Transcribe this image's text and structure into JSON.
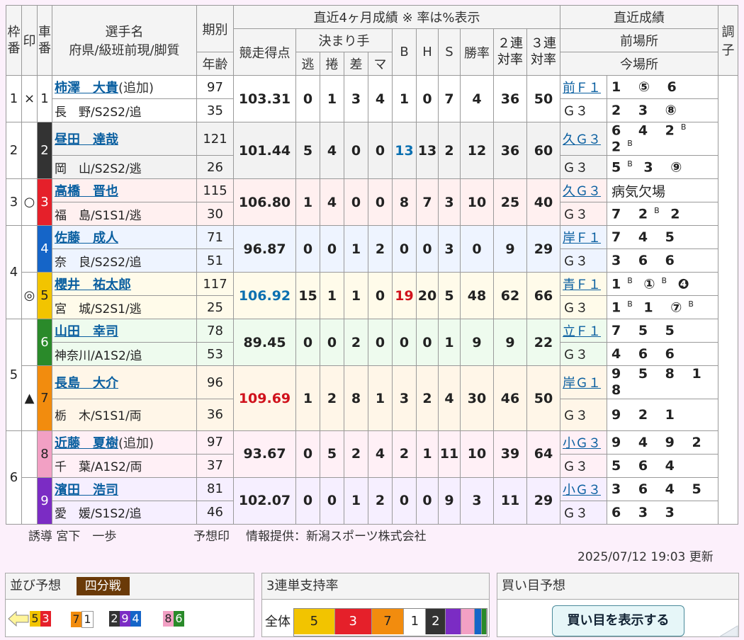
{
  "header": {
    "col_waku": "枠番",
    "col_mark": "印",
    "col_car": "車番",
    "col_name": "選手名",
    "col_name_sub": "府県/級班前現/脚質",
    "col_term": "期別",
    "col_age": "年齢",
    "col_recent4": "直近4ヶ月成績 ※ 率は%表示",
    "col_score": "競走得点",
    "col_kimarite": "決まり手",
    "col_nige": "逃",
    "col_makuri": "捲",
    "col_sashi": "差",
    "col_ma": "マ",
    "col_b": "B",
    "col_h": "H",
    "col_s": "S",
    "col_win": "勝率",
    "col_ren2_a": "２連",
    "col_ren2_b": "対率",
    "col_ren3_a": "３連",
    "col_ren3_b": "対率",
    "col_recent": "直近成績",
    "col_prev": "前場所",
    "col_current": "今場所",
    "col_cond_a": "調",
    "col_cond_b": "子"
  },
  "riders": [
    {
      "waku": "1",
      "mark": "×",
      "car": "1",
      "name": "柿澤　大貴",
      "tag": "(追加)",
      "info": "長　野/S2S2/追",
      "term": "97",
      "age": "35",
      "score": "103.31",
      "nige": "0",
      "makuri": "1",
      "sashi": "3",
      "ma": "4",
      "b": "1",
      "h": "0",
      "s": "7",
      "win": "4",
      "ren2": "36",
      "ren3": "50",
      "prev_label": "前Ｆ１",
      "prev_res": "1 ⑤ 6",
      "cur_label": "Ｇ３",
      "cur_res": "2 3 ⑧"
    },
    {
      "waku": "2",
      "mark": "",
      "car": "2",
      "name": "昼田　達哉",
      "tag": "",
      "info": "岡　山/S2S2/逃",
      "term": "121",
      "age": "26",
      "score": "101.44",
      "nige": "5",
      "makuri": "4",
      "sashi": "0",
      "ma": "0",
      "b": "13",
      "h": "13",
      "s": "2",
      "win": "12",
      "ren2": "36",
      "ren3": "60",
      "prev_label": "久Ｇ３",
      "prev_res": "6 4 2ᴮ 2ᴮ",
      "cur_label": "Ｇ３",
      "cur_res": "5ᴮ 3 ⑨"
    },
    {
      "waku": "3",
      "mark": "○",
      "car": "3",
      "name": "高橋　晋也",
      "tag": "",
      "info": "福　島/S1S1/逃",
      "term": "115",
      "age": "30",
      "score": "106.80",
      "nige": "1",
      "makuri": "4",
      "sashi": "0",
      "ma": "0",
      "b": "8",
      "h": "7",
      "s": "3",
      "win": "10",
      "ren2": "25",
      "ren3": "40",
      "prev_label": "久Ｇ３",
      "prev_res": "病気欠場",
      "cur_label": "Ｇ３",
      "cur_res": "7 2ᴮ 2"
    },
    {
      "waku": "4",
      "mark": "",
      "car": "4",
      "name": "佐藤　成人",
      "tag": "",
      "info": "奈　良/S2S2/追",
      "term": "71",
      "age": "51",
      "score": "96.87",
      "nige": "0",
      "makuri": "0",
      "sashi": "1",
      "ma": "2",
      "b": "0",
      "h": "0",
      "s": "3",
      "win": "0",
      "ren2": "9",
      "ren3": "29",
      "prev_label": "岸Ｆ１",
      "prev_res": "7 4 5",
      "cur_label": "Ｇ３",
      "cur_res": "3 6 6"
    },
    {
      "waku": "4",
      "mark": "◎",
      "car": "5",
      "name": "櫻井　祐太郎",
      "tag": "",
      "info": "宮　城/S2S1/逃",
      "term": "117",
      "age": "25",
      "score": "106.92",
      "nige": "15",
      "makuri": "1",
      "sashi": "1",
      "ma": "0",
      "b": "19",
      "h": "20",
      "s": "5",
      "win": "48",
      "ren2": "62",
      "ren3": "66",
      "prev_label": "青Ｆ１",
      "prev_res": "1ᴮ ①ᴮ ❹",
      "cur_label": "Ｇ３",
      "cur_res": "1ᴮ 1 ⑦ᴮ"
    },
    {
      "waku": "5",
      "mark": "",
      "car": "6",
      "name": "山田　幸司",
      "tag": "",
      "info": "神奈川/A1S2/追",
      "term": "78",
      "age": "53",
      "score": "89.45",
      "nige": "0",
      "makuri": "0",
      "sashi": "2",
      "ma": "0",
      "b": "0",
      "h": "0",
      "s": "1",
      "win": "9",
      "ren2": "9",
      "ren3": "22",
      "prev_label": "立Ｆ１",
      "prev_res": "7 5 5",
      "cur_label": "Ｇ３",
      "cur_res": "4 6 6"
    },
    {
      "waku": "5",
      "mark": "▲",
      "car": "7",
      "name": "長島　大介",
      "tag": "",
      "info": "栃　木/S1S1/両",
      "term": "96",
      "age": "36",
      "score": "109.69",
      "nige": "1",
      "makuri": "2",
      "sashi": "8",
      "ma": "1",
      "b": "3",
      "h": "2",
      "s": "4",
      "win": "30",
      "ren2": "46",
      "ren3": "50",
      "prev_label": "岸Ｇ１",
      "prev_res": "9 5 8 1 8",
      "cur_label": "Ｇ３",
      "cur_res": "9 2 1"
    },
    {
      "waku": "6",
      "mark": "",
      "car": "8",
      "name": "近藤　夏樹",
      "tag": "(追加)",
      "info": "千　葉/A1S2/両",
      "term": "97",
      "age": "37",
      "score": "93.67",
      "nige": "0",
      "makuri": "5",
      "sashi": "2",
      "ma": "4",
      "b": "2",
      "h": "1",
      "s": "11",
      "win": "10",
      "ren2": "39",
      "ren3": "64",
      "prev_label": "小Ｇ３",
      "prev_res": "9 4 9 2",
      "cur_label": "Ｇ３",
      "cur_res": "5 6 4"
    },
    {
      "waku": "6",
      "mark": "",
      "car": "9",
      "name": "濱田　浩司",
      "tag": "",
      "info": "愛　媛/S1S2/追",
      "term": "81",
      "age": "46",
      "score": "102.07",
      "nige": "0",
      "makuri": "0",
      "sashi": "1",
      "ma": "2",
      "b": "0",
      "h": "0",
      "s": "9",
      "win": "3",
      "ren2": "11",
      "ren3": "29",
      "prev_label": "小Ｇ３",
      "prev_res": "3 6 4 5",
      "cur_label": "Ｇ３",
      "cur_res": "6 3 3"
    }
  ],
  "footer": {
    "guide": "誘導 宮下　一歩",
    "forecast_label": "予想印",
    "provider": "情報提供：新潟スポーツ株式会社",
    "updated": "2025/07/12 19:03 更新"
  },
  "lineup": {
    "title": "並び予想",
    "badge": "四分戦",
    "groups": [
      {
        "cars": [
          "5",
          "3"
        ]
      },
      {
        "cars": [
          "7",
          "1"
        ]
      },
      {
        "cars": [
          "2",
          "9",
          "4"
        ]
      },
      {
        "cars": [
          "8",
          "6"
        ]
      }
    ]
  },
  "support": {
    "title": "3連単支持率",
    "row_label": "全体",
    "segments": [
      {
        "car": "5",
        "share": 0.19
      },
      {
        "car": "3",
        "share": 0.17
      },
      {
        "car": "7",
        "share": 0.15
      },
      {
        "car": "1",
        "share": 0.1
      },
      {
        "car": "2",
        "share": 0.09
      },
      {
        "car": "9",
        "share": 0.07
      },
      {
        "car": "8",
        "share": 0.06
      },
      {
        "car": "4",
        "share": 0.03
      },
      {
        "car": "6",
        "share": 0.02
      }
    ]
  },
  "buy": {
    "title": "買い目予想",
    "button": "買い目を表示する"
  },
  "colors": {
    "score_high": "#d0121c",
    "score_second": "#0a6fb0",
    "link": "#0a5fa0",
    "badge_bg": "#6a3a08"
  }
}
